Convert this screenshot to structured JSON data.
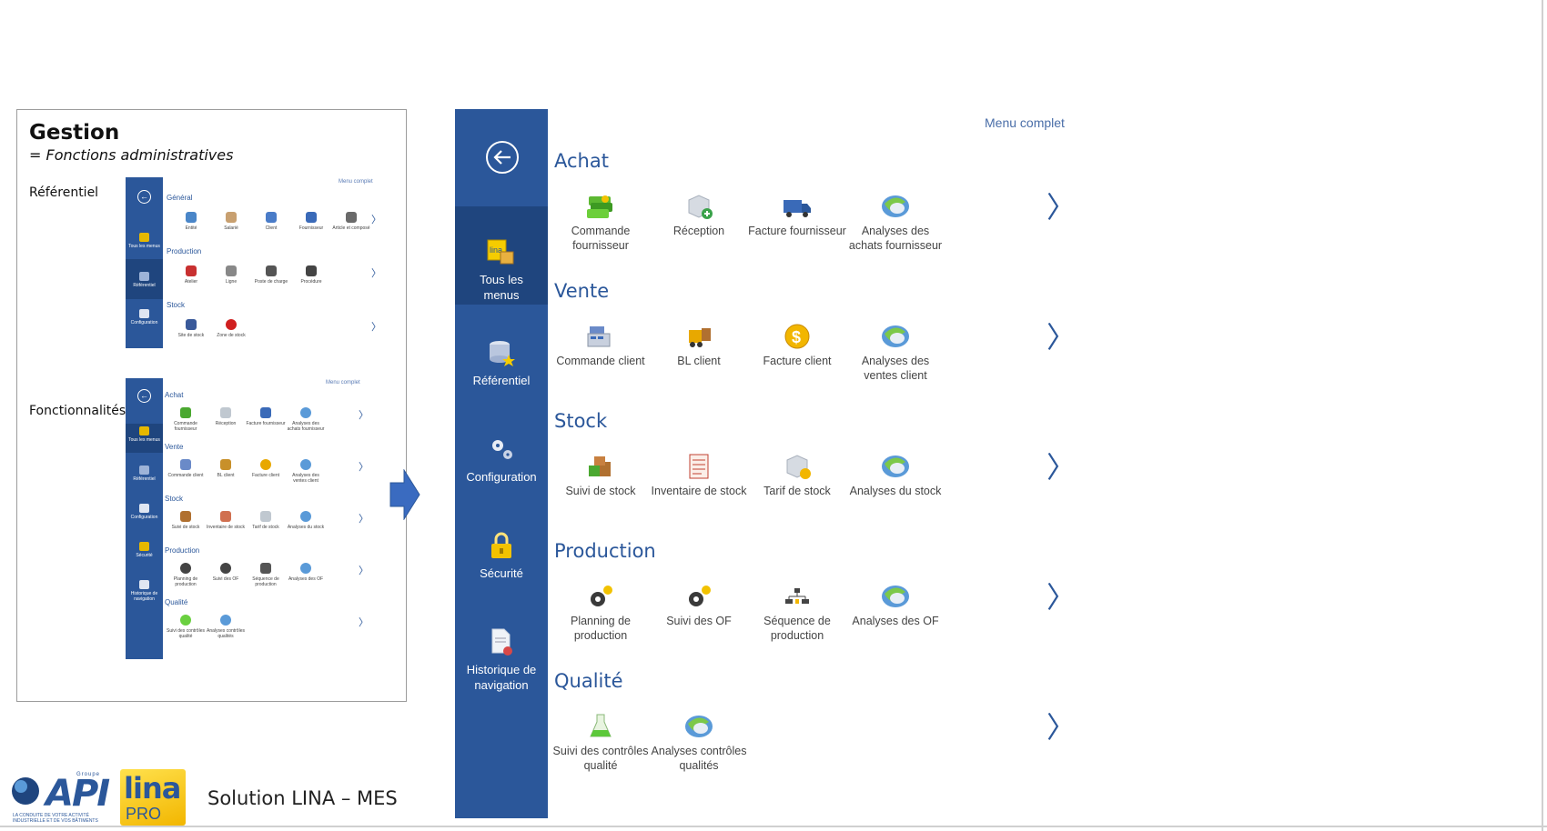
{
  "card": {
    "title": "Gestion",
    "subtitle": "= Fonctions administratives",
    "label_referentiel": "Référentiel",
    "label_fonctionnalites": "Fonctionnalités"
  },
  "mini1": {
    "menu_link": "Menu complet",
    "side": [
      "Tous les menus",
      "Référentiel",
      "Configuration"
    ],
    "sections": [
      {
        "title": "Général",
        "items": [
          "Entité",
          "Salarié",
          "Client",
          "Fournisseur",
          "Article et composé"
        ]
      },
      {
        "title": "Production",
        "items": [
          "Atelier",
          "Ligne",
          "Poste de charge",
          "Procédure"
        ]
      },
      {
        "title": "Stock",
        "items": [
          "Site de stock",
          "Zone de stock"
        ]
      }
    ]
  },
  "mini2": {
    "menu_link": "Menu complet",
    "side": [
      "Tous les menus",
      "Référentiel",
      "Configuration",
      "Sécurité",
      "Historique de navigation"
    ],
    "sections": [
      {
        "title": "Achat",
        "items": [
          "Commande fournisseur",
          "Réception",
          "Facture fournisseur",
          "Analyses des achats fournisseur"
        ]
      },
      {
        "title": "Vente",
        "items": [
          "Commande client",
          "BL client",
          "Facture client",
          "Analyses des ventes client"
        ]
      },
      {
        "title": "Stock",
        "items": [
          "Suivi de stock",
          "Inventaire de stock",
          "Tarif de stock",
          "Analyses du stock"
        ]
      },
      {
        "title": "Production",
        "items": [
          "Planning de production",
          "Suivi des OF",
          "Séquence de production",
          "Analyses des OF"
        ]
      },
      {
        "title": "Qualité",
        "items": [
          "Suivi des contrôles qualité",
          "Analyses contrôles qualités"
        ]
      }
    ]
  },
  "big": {
    "menu_link": "Menu complet",
    "side": {
      "all_menus": "Tous les menus",
      "referentiel": "Référentiel",
      "configuration": "Configuration",
      "securite": "Sécurité",
      "historique": "Historique de navigation"
    },
    "sections": [
      {
        "title": "Achat",
        "items": [
          "Commande fournisseur",
          "Réception",
          "Facture fournisseur",
          "Analyses des achats fournisseur"
        ]
      },
      {
        "title": "Vente",
        "items": [
          "Commande client",
          "BL client",
          "Facture client",
          "Analyses des ventes client"
        ]
      },
      {
        "title": "Stock",
        "items": [
          "Suivi de stock",
          "Inventaire de stock",
          "Tarif de stock",
          "Analyses du stock"
        ]
      },
      {
        "title": "Production",
        "items": [
          "Planning de production",
          "Suivi des OF",
          "Séquence de production",
          "Analyses des OF"
        ]
      },
      {
        "title": "Qualité",
        "items": [
          "Suivi des contrôles qualité",
          "Analyses contrôles qualités"
        ]
      }
    ]
  },
  "footer": {
    "api_group": "Groupe",
    "api_name": "API",
    "api_tagline": "LA CONDUITE DE VOTRE ACTIVITÉ INDUSTRIELLE ET DE VOS BÂTIMENTS",
    "lina_name": "lina",
    "lina_pro": "PRO",
    "solution": "Solution LINA – MES"
  },
  "colors": {
    "accent": "#2b579a",
    "accent_dark": "#1f457e"
  }
}
